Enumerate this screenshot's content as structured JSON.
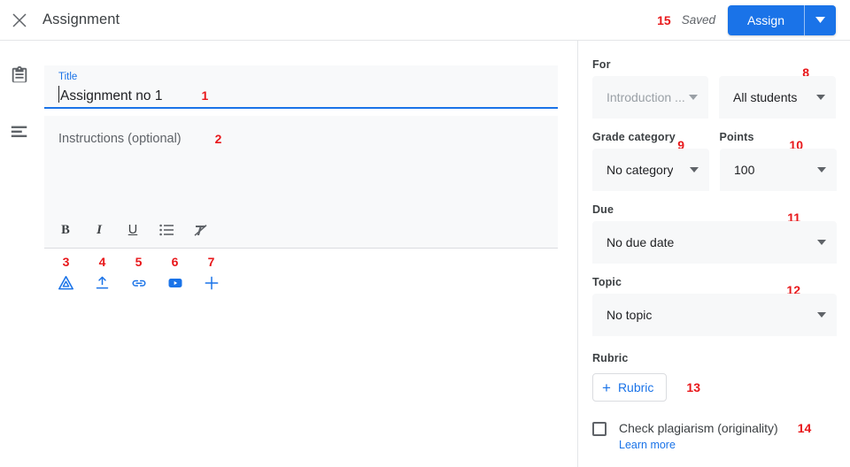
{
  "header": {
    "title": "Assignment",
    "close_icon": "close-icon",
    "saved_status": "Saved",
    "assign_label": "Assign",
    "assign_menu_icon": "chevron-down-icon",
    "marker_15": "15"
  },
  "rail": {
    "items": [
      {
        "icon": "assignment-clipboard-icon"
      },
      {
        "icon": "description-lines-icon"
      }
    ]
  },
  "main": {
    "title_field": {
      "label": "Title",
      "value": "Assignment no 1",
      "marker": "1"
    },
    "instructions": {
      "placeholder": "Instructions (optional)",
      "value": "",
      "marker": "2"
    },
    "format_toolbar": [
      {
        "name": "bold-button",
        "glyph": "B"
      },
      {
        "name": "italic-button",
        "glyph": "I"
      },
      {
        "name": "underline-button",
        "glyph": "U"
      },
      {
        "name": "bulleted-list-button",
        "glyph": "list-icon"
      },
      {
        "name": "clear-formatting-button",
        "glyph": "clear-format-icon"
      }
    ],
    "attachments": [
      {
        "name": "add-drive-button",
        "icon": "google-drive-icon",
        "marker": "3"
      },
      {
        "name": "upload-file-button",
        "icon": "upload-icon",
        "marker": "4"
      },
      {
        "name": "add-link-button",
        "icon": "link-icon",
        "marker": "5"
      },
      {
        "name": "add-youtube-button",
        "icon": "youtube-icon",
        "marker": "6"
      },
      {
        "name": "create-button",
        "icon": "plus-icon",
        "marker": "7"
      }
    ]
  },
  "side": {
    "for": {
      "label": "For",
      "class_value": "Introduction ...",
      "students_value": "All students",
      "students_marker": "8"
    },
    "grade_category": {
      "label": "Grade category",
      "value": "No category",
      "marker": "9"
    },
    "points": {
      "label": "Points",
      "value": "100",
      "marker": "10"
    },
    "due": {
      "label": "Due",
      "value": "No due date",
      "marker": "11"
    },
    "topic": {
      "label": "Topic",
      "value": "No topic",
      "marker": "12"
    },
    "rubric": {
      "label": "Rubric",
      "button_label": "Rubric",
      "button_plus": "+",
      "marker": "13"
    },
    "plagiarism": {
      "label": "Check plagiarism (originality)",
      "learn_more": "Learn more",
      "checked": false,
      "marker": "14"
    }
  },
  "colors": {
    "accent": "#1a73e8",
    "marker": "#e8171a",
    "field_bg": "#f8f9fa",
    "text": "#3c4043"
  }
}
